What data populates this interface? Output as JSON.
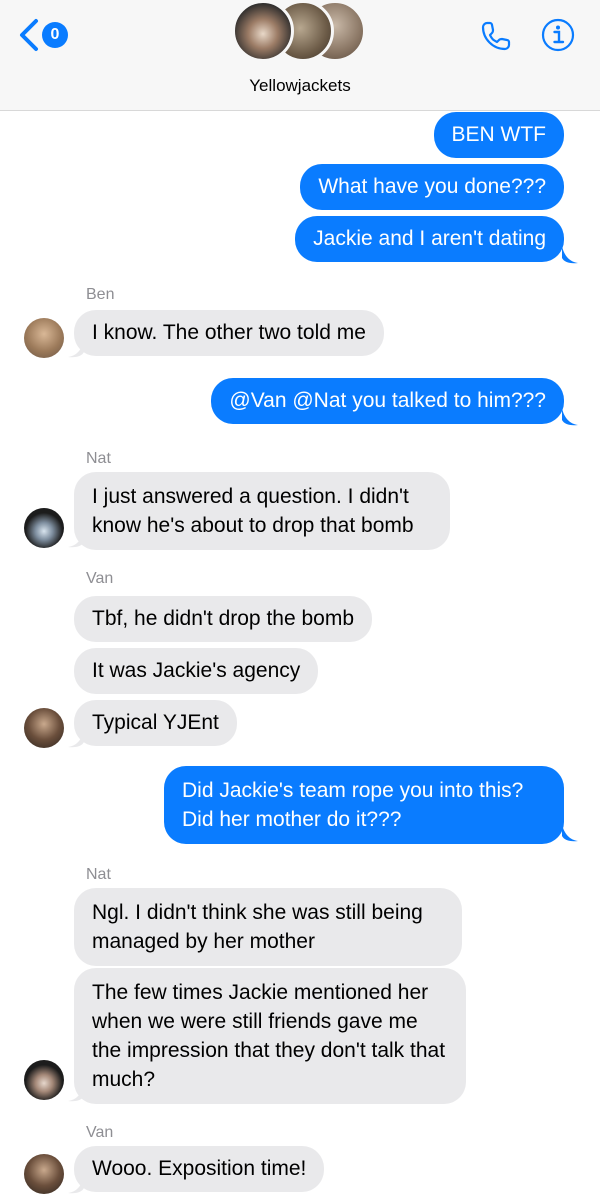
{
  "header": {
    "back_badge": "0",
    "title": "Yellowjackets"
  },
  "messages": [
    {
      "from": "me",
      "text": "BEN WTF"
    },
    {
      "from": "me",
      "text": "What have you done???"
    },
    {
      "from": "me",
      "text": "Jackie and I aren't dating"
    },
    {
      "from": "Ben",
      "sender_label": "Ben",
      "text": "I know. The other two told me"
    },
    {
      "from": "me",
      "text": "@Van @Nat you talked to him???"
    },
    {
      "from": "Nat",
      "sender_label": "Nat",
      "text": "I just answered a question. I didn't know he's about to drop that bomb"
    },
    {
      "from": "Van",
      "sender_label": "Van",
      "text": "Tbf, he didn't drop the bomb"
    },
    {
      "from": "Van",
      "text": "It was Jackie's agency"
    },
    {
      "from": "Van",
      "text": "Typical YJEnt"
    },
    {
      "from": "me",
      "text": "Did Jackie's team rope you into this? Did her mother do it???"
    },
    {
      "from": "Nat",
      "sender_label": "Nat",
      "text": "Ngl. I didn't think she was still being managed by her mother"
    },
    {
      "from": "Nat",
      "text": "The few times Jackie mentioned her when we were still friends gave me the impression that they don't talk that much?"
    },
    {
      "from": "Van",
      "sender_label": "Van",
      "text": "Wooo. Exposition time!"
    }
  ],
  "colors": {
    "outgoing": "#0a7cff",
    "incoming": "#e9e9eb",
    "sender_label": "#8e8e93",
    "header_bg": "#f7f7f7"
  },
  "icons": {
    "back": "chevron-left-icon",
    "call": "phone-icon",
    "info": "info-icon"
  }
}
